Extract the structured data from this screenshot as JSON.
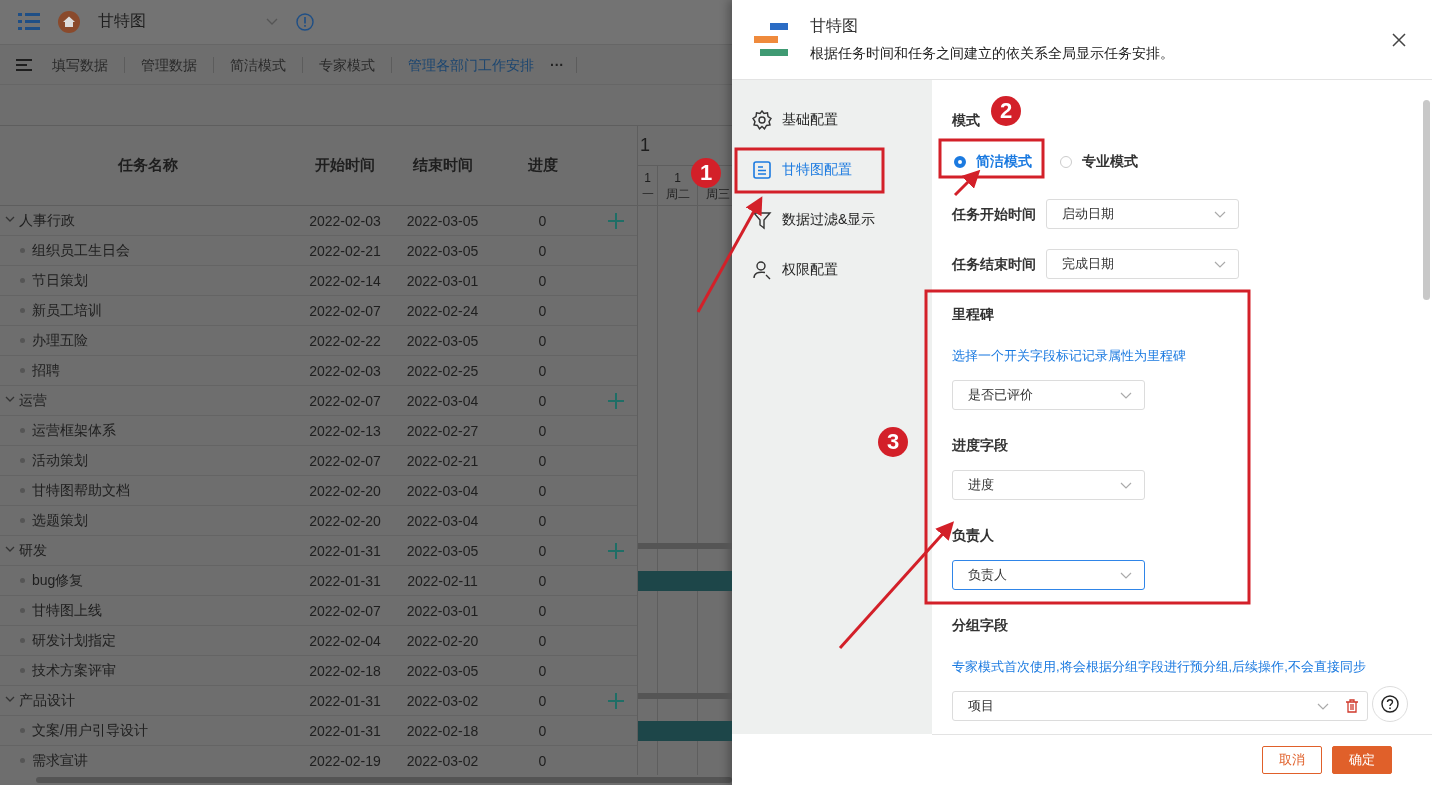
{
  "app_bar": {
    "title": "甘特图"
  },
  "toolbar": {
    "tabs": [
      {
        "label": "填写数据",
        "selected": false
      },
      {
        "label": "管理数据",
        "selected": false
      },
      {
        "label": "简洁模式",
        "selected": false
      },
      {
        "label": "专家模式",
        "selected": false
      },
      {
        "label": "管理各部门工作安排",
        "selected": true
      }
    ],
    "more": "···"
  },
  "table": {
    "columns": [
      "任务名称",
      "开始时间",
      "结束时间",
      "进度"
    ],
    "gantt_header": {
      "month": "1",
      "days": [
        {
          "date": "1",
          "weekday": "一"
        },
        {
          "date": "1",
          "weekday": "周二"
        },
        {
          "weekday": "周三"
        }
      ]
    },
    "rows": [
      {
        "name": "人事行政",
        "start": "2022-02-03",
        "end": "2022-03-05",
        "progress": "0",
        "expanded": true,
        "children": [
          {
            "name": "组织员工生日会",
            "start": "2022-02-21",
            "end": "2022-03-05",
            "progress": "0"
          },
          {
            "name": "节日策划",
            "start": "2022-02-14",
            "end": "2022-03-01",
            "progress": "0"
          },
          {
            "name": "新员工培训",
            "start": "2022-02-07",
            "end": "2022-02-24",
            "progress": "0"
          },
          {
            "name": "办理五险",
            "start": "2022-02-22",
            "end": "2022-03-05",
            "progress": "0"
          },
          {
            "name": "招聘",
            "start": "2022-02-03",
            "end": "2022-02-25",
            "progress": "0"
          }
        ]
      },
      {
        "name": "运营",
        "start": "2022-02-07",
        "end": "2022-03-04",
        "progress": "0",
        "expanded": true,
        "children": [
          {
            "name": "运营框架体系",
            "start": "2022-02-13",
            "end": "2022-02-27",
            "progress": "0"
          },
          {
            "name": "活动策划",
            "start": "2022-02-07",
            "end": "2022-02-21",
            "progress": "0"
          },
          {
            "name": "甘特图帮助文档",
            "start": "2022-02-20",
            "end": "2022-03-04",
            "progress": "0"
          },
          {
            "name": "选题策划",
            "start": "2022-02-20",
            "end": "2022-03-04",
            "progress": "0"
          }
        ]
      },
      {
        "name": "研发",
        "start": "2022-01-31",
        "end": "2022-03-05",
        "progress": "0",
        "expanded": true,
        "bar": true,
        "children": [
          {
            "name": "bug修复",
            "start": "2022-01-31",
            "end": "2022-02-11",
            "progress": "0",
            "bar": true
          },
          {
            "name": "甘特图上线",
            "start": "2022-02-07",
            "end": "2022-03-01",
            "progress": "0"
          },
          {
            "name": "研发计划指定",
            "start": "2022-02-04",
            "end": "2022-02-20",
            "progress": "0"
          },
          {
            "name": "技术方案评审",
            "start": "2022-02-18",
            "end": "2022-03-05",
            "progress": "0"
          }
        ]
      },
      {
        "name": "产品设计",
        "start": "2022-01-31",
        "end": "2022-03-02",
        "progress": "0",
        "expanded": true,
        "bar": true,
        "children": [
          {
            "name": "文案/用户引导设计",
            "start": "2022-01-31",
            "end": "2022-02-18",
            "progress": "0",
            "bar": true
          },
          {
            "name": "需求宣讲",
            "start": "2022-02-19",
            "end": "2022-03-02",
            "progress": "0"
          }
        ]
      }
    ]
  },
  "drawer": {
    "title": "甘特图",
    "description": "根据任务时间和任务之间建立的依关系全局显示任务安排。",
    "nav": [
      {
        "label": "基础配置",
        "selected": false
      },
      {
        "label": "甘特图配置",
        "selected": true
      },
      {
        "label": "数据过滤&显示",
        "selected": false
      },
      {
        "label": "权限配置",
        "selected": false
      }
    ],
    "mode": {
      "label": "模式",
      "options": [
        {
          "label": "简洁模式",
          "selected": true
        },
        {
          "label": "专业模式",
          "selected": false
        }
      ]
    },
    "fields": [
      {
        "kind": "inline",
        "label": "任务开始时间",
        "value": "启动日期"
      },
      {
        "kind": "inline",
        "label": "任务结束时间",
        "value": "完成日期"
      },
      {
        "kind": "stacked",
        "label": "里程碑",
        "hint": "选择一个开关字段标记记录属性为里程碑",
        "value": "是否已评价"
      },
      {
        "kind": "stacked",
        "label": "进度字段",
        "value": "进度"
      },
      {
        "kind": "stacked",
        "label": "负责人",
        "value": "负责人",
        "focused": true
      },
      {
        "kind": "wide",
        "label": "分组字段",
        "hint": "专家模式首次使用,将会根据分组字段进行预分组,后续操作,不会直接同步",
        "value": "项目"
      }
    ],
    "buttons": [
      {
        "label": "取消",
        "kind": "secondary"
      },
      {
        "label": "确定",
        "kind": "primary"
      }
    ]
  },
  "annotations": [
    {
      "number": "1"
    },
    {
      "number": "2"
    },
    {
      "number": "3"
    }
  ]
}
